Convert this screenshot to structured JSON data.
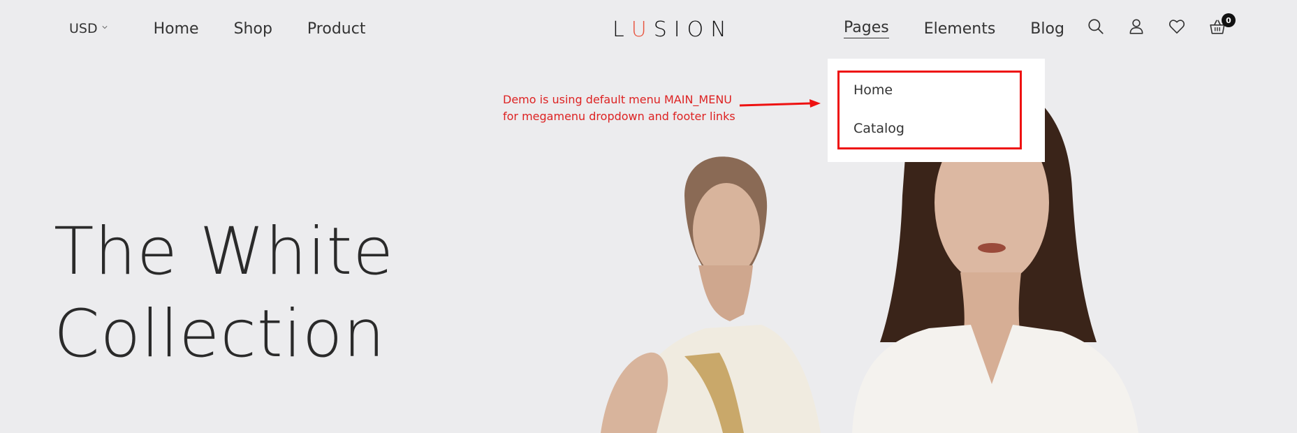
{
  "header": {
    "currency": "USD",
    "nav_left": [
      "Home",
      "Shop",
      "Product"
    ],
    "logo": {
      "before": "L",
      "accent": "U",
      "after": "SION"
    },
    "nav_right": [
      "Pages",
      "Elements",
      "Blog"
    ],
    "active_nav": "Pages",
    "cart_count": "0",
    "icons": [
      "search-icon",
      "user-icon",
      "heart-icon",
      "cart-icon"
    ]
  },
  "dropdown": {
    "items": [
      "Home",
      "Catalog"
    ]
  },
  "annotation": {
    "line1": "Demo is using default menu MAIN_MENU",
    "line2": "for megamenu dropdown and footer links"
  },
  "hero": {
    "line1": "The White",
    "line2": "Collection"
  },
  "colors": {
    "background": "#ececee",
    "logo_accent": "#e8543f",
    "annotation_red": "#dd2222"
  }
}
